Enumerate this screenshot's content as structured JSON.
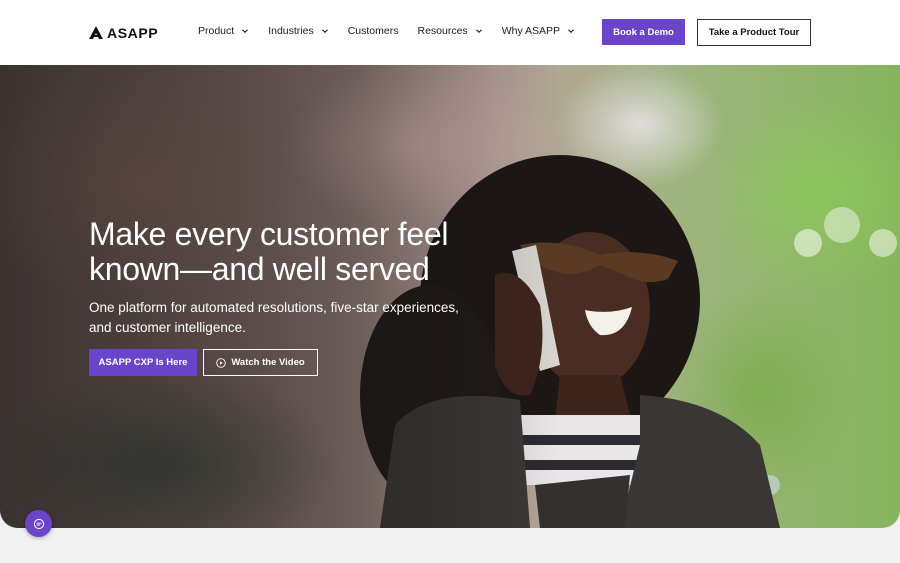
{
  "brand": {
    "name": "ASAPP",
    "accent": "#6a45c9"
  },
  "nav": {
    "items": [
      {
        "label": "Product",
        "has_dropdown": true
      },
      {
        "label": "Industries",
        "has_dropdown": true
      },
      {
        "label": "Customers",
        "has_dropdown": false
      },
      {
        "label": "Resources",
        "has_dropdown": true
      },
      {
        "label": "Why ASAPP",
        "has_dropdown": true
      }
    ],
    "book_demo_label": "Book a Demo",
    "product_tour_label": "Take a Product Tour"
  },
  "hero": {
    "title_line1": "Make every customer feel",
    "title_line2": "known—and well served",
    "subtitle_line1": "One platform for automated resolutions, five-star experiences,",
    "subtitle_line2": "and customer intelligence.",
    "primary_cta": "ASAPP CXP Is Here",
    "secondary_cta": "Watch the Video",
    "secondary_cta_icon": "play-circle-icon"
  },
  "chat": {
    "icon": "chat-bubble-icon"
  }
}
